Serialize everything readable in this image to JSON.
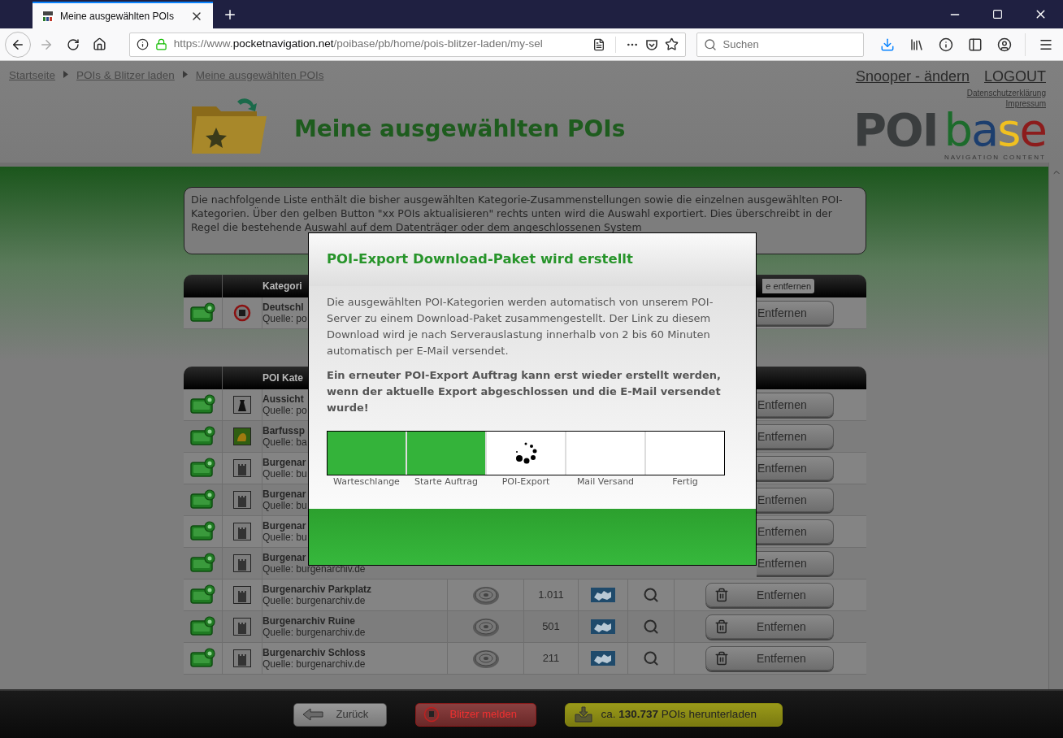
{
  "browser": {
    "tab_title": "Meine ausgewählten POIs",
    "url": {
      "scheme": "https://www.",
      "domain": "pocketnavigation.net",
      "path": "/poibase/pb/home/pois-blitzer-laden/my-sel"
    },
    "search_placeholder": "Suchen"
  },
  "breadcrumb": [
    "Startseite",
    "POIs & Blitzer laden",
    "Meine ausgewählten POIs"
  ],
  "user_links": [
    "Snooper - ändern",
    "LOGOUT"
  ],
  "legal_links": [
    "Datenschutzerklärung",
    "Impressum"
  ],
  "page_title": "Meine ausgewählten POIs",
  "logo": {
    "word": "POI",
    "letters": [
      {
        "char": "b",
        "color": "#1d6b2c"
      },
      {
        "char": "a",
        "color": "#1c3e6e"
      },
      {
        "char": "s",
        "color": "#f0c020"
      },
      {
        "char": "e",
        "color": "#8c1c1c"
      }
    ],
    "tagline": "NAVIGATION CONTENT"
  },
  "intro": "Die nachfolgende Liste enthält die bisher ausgewählten Kategorie-Zusammenstellungen sowie die einzelnen ausgewählten POI-Kategorien. Über den gelben Button \"xx POIs aktualisieren\" rechts unten wird die Auswahl exportiert. Dies überschreibt in der Regel die bestehende Auswahl auf dem Datenträger oder dem angeschlossenen System",
  "compilations": {
    "header": "Kategori",
    "header_button": "e entfernen",
    "rows": [
      {
        "kind": "speedcam",
        "name": "Deutschl",
        "source": "Quelle: po",
        "button": "Entfernen"
      }
    ]
  },
  "categories": {
    "header": "POI Kate",
    "rows": [
      {
        "kind": "tower",
        "name": "Aussicht",
        "source": "Quelle: po",
        "button": "Entfernen"
      },
      {
        "kind": "barefoot",
        "name": "Barfussp",
        "source": "Quelle: ba",
        "button": "Entfernen"
      },
      {
        "kind": "castle",
        "name": "Burgenar",
        "source": "Quelle: bu",
        "button": "Entfernen"
      },
      {
        "kind": "castle",
        "name": "Burgenar",
        "source": "Quelle: bu",
        "button": "Entfernen"
      },
      {
        "kind": "castle",
        "name": "Burgenar",
        "source": "Quelle: bu",
        "button": "Entfernen"
      },
      {
        "kind": "castle",
        "name": "Burgenar",
        "source": "Quelle: burgenarchiv.de",
        "button": "Entfernen"
      },
      {
        "kind": "castle",
        "name": "Burgenarchiv Parkplatz",
        "source": "Quelle: burgenarchiv.de",
        "count": "1.011",
        "button": "Entfernen"
      },
      {
        "kind": "castle",
        "name": "Burgenarchiv Ruine",
        "source": "Quelle: burgenarchiv.de",
        "count": "501",
        "button": "Entfernen"
      },
      {
        "kind": "castle",
        "name": "Burgenarchiv Schloss",
        "source": "Quelle: burgenarchiv.de",
        "count": "211",
        "button": "Entfernen"
      }
    ]
  },
  "modal": {
    "title": "POI-Export Download-Paket wird erstellt",
    "text": "Die ausgewählten POI-Kategorien werden automatisch von unserem POI-Server zu einem Download-Paket zusammengestellt. Der Link zu diesem Download wird je nach Serverauslastung innerhalb von 2 bis 60 Minuten automatisch per E-Mail versendet.",
    "notice": "Ein erneuter POI-Export Auftrag kann erst wieder erstellt werden, wenn der aktuelle Export abgeschlossen und die E-Mail versendet wurde!",
    "steps": [
      {
        "label": "Warteschlange",
        "done": true,
        "active": false
      },
      {
        "label": "Starte Auftrag",
        "done": true,
        "active": false
      },
      {
        "label": "POI-Export",
        "done": false,
        "active": true
      },
      {
        "label": "Mail Versand",
        "done": false,
        "active": false
      },
      {
        "label": "Fertig",
        "done": false,
        "active": false
      }
    ]
  },
  "footer": {
    "back": "Zurück",
    "report": "Blitzer melden",
    "download": "ca. **130.737** POIs herunterladen"
  }
}
